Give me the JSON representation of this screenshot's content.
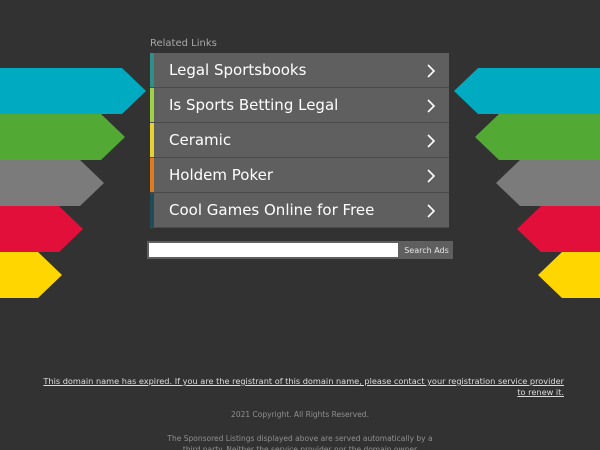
{
  "related_links": {
    "title": "Related Links",
    "items": [
      {
        "label": "Legal Sportsbooks",
        "accent": "#2f8f8a"
      },
      {
        "label": "Is Sports Betting Legal",
        "accent": "#9fd046"
      },
      {
        "label": "Ceramic",
        "accent": "#e8d230"
      },
      {
        "label": "Holdem Poker",
        "accent": "#e07a1c"
      },
      {
        "label": "Cool Games Online for Free",
        "accent": "#1f4c57"
      }
    ]
  },
  "search": {
    "placeholder": "",
    "button_label": "Search Ads"
  },
  "side_arrow_colors": [
    "#00aac0",
    "#52aa35",
    "#7b7b7b",
    "#e10f39",
    "#ffd600"
  ],
  "footer": {
    "expired_line1": "This domain name has expired. If you are the registrant of this domain name, please contact your registration service provider",
    "expired_line2": "to renew it.",
    "copyright": "2021 Copyright. All Rights Reserved.",
    "disclaimer": "The Sponsored Listings displayed above are served automatically by a third party. Neither the service provider nor the domain owner"
  }
}
